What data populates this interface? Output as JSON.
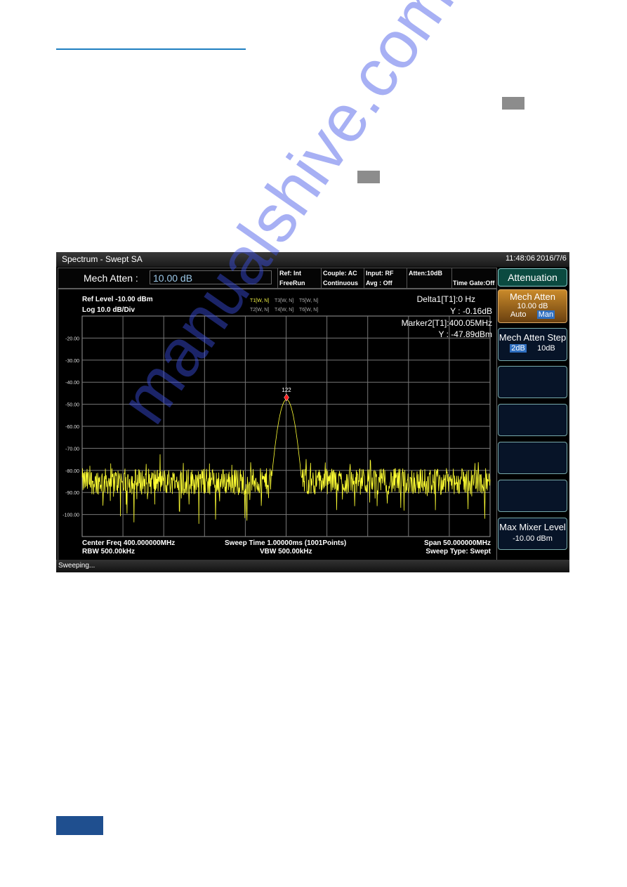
{
  "colors": {
    "accent": "#1f7fc0",
    "trace": "#ffff33",
    "marker": "#ff2020",
    "watermark": "#3c50e6"
  },
  "watermark": "manualshive.com",
  "screen": {
    "title": "Spectrum - Swept SA",
    "time": "11:48:06",
    "date": "2016/7/6",
    "input_label": "Mech Atten :",
    "input_value": "10.00 dB",
    "status_cells": [
      [
        "Ref: Int",
        "FreeRun"
      ],
      [
        "Couple: AC",
        "Continuous"
      ],
      [
        "Input: RF",
        "Avg : Off"
      ],
      [
        "Atten:10dB",
        ""
      ],
      [
        "",
        "Time Gate:Off"
      ]
    ],
    "ref_level": "Ref Level -10.00 dBm",
    "scale": "Log 10.0 dB/Div",
    "traces": [
      "T1[W, N]",
      "T3[W, N]",
      "T5[W, N]",
      "T2[W, N]",
      "T4[W, N]",
      "T6[W, N]"
    ],
    "delta_line": "Delta1[T1]:0  Hz",
    "delta_y": "Y : -0.16dB",
    "marker_line": "Marker2[T1]:400.05MHz",
    "marker_y": "Y : -47.89dBm",
    "marker_label": "122",
    "center_freq": "Center Freq 400.000000MHz",
    "rbw": "RBW 500.00kHz",
    "sweep_time": "Sweep Time 1.00000ms (1001Points)",
    "vbw": "VBW 500.00kHz",
    "span": "Span 50.000000MHz",
    "sweep_type": "Sweep Type: Swept",
    "status_text": "Sweeping..."
  },
  "softkeys": {
    "title": "Attenuation",
    "mech_atten": {
      "label": "Mech Atten",
      "value": "10.00 dB",
      "opt1": "Auto",
      "opt2": "Man",
      "selected": "Man"
    },
    "mech_atten_step": {
      "label": "Mech Atten Step",
      "opt1": "2dB",
      "opt2": "10dB",
      "selected": "2dB"
    },
    "max_mixer": {
      "label": "Max Mixer Level",
      "value": "-10.00 dBm"
    }
  },
  "chart_data": {
    "type": "line",
    "xlabel": "",
    "ylabel": "",
    "ytick_labels": [
      "-20.00",
      "-30.00",
      "-40.00",
      "-50.00",
      "-60.00",
      "-70.00",
      "-80.00",
      "-90.00",
      "-100.00"
    ],
    "ylim": [
      -110,
      -10
    ],
    "xlim_mhz": [
      375,
      425
    ],
    "grid": true,
    "series": [
      {
        "description_values": {
          "peak_freq_mhz": 400.05,
          "peak_dbm": -47.89,
          "noise_floor_dbm": -85
        }
      }
    ],
    "markers": [
      {
        "label": "122",
        "x_mhz": 400.05,
        "y_dbm": -47.89
      }
    ]
  }
}
